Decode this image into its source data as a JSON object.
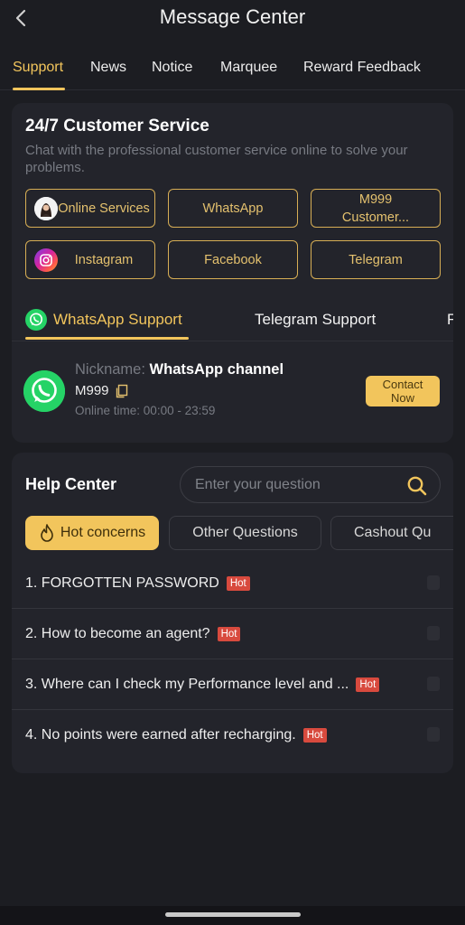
{
  "header": {
    "title": "Message Center"
  },
  "tabs": [
    {
      "label": "Support",
      "active": true
    },
    {
      "label": "News",
      "active": false
    },
    {
      "label": "Notice",
      "active": false
    },
    {
      "label": "Marquee",
      "active": false
    },
    {
      "label": "Reward Feedback",
      "active": false
    }
  ],
  "customer_service": {
    "title": "24/7 Customer Service",
    "subtitle": "Chat with the professional customer service online to solve your problems.",
    "buttons": [
      {
        "label": "Online Services",
        "icon": "agent-avatar-icon"
      },
      {
        "label": "WhatsApp",
        "icon": ""
      },
      {
        "label": "M999 Customer...",
        "icon": ""
      },
      {
        "label": "Instagram",
        "icon": "instagram-icon"
      },
      {
        "label": "Facebook",
        "icon": ""
      },
      {
        "label": "Telegram",
        "icon": ""
      }
    ],
    "support_tabs": [
      {
        "label": "WhatsApp Support",
        "active": true
      },
      {
        "label": "Telegram Support",
        "active": false
      },
      {
        "label": "F",
        "active": false
      }
    ],
    "channel": {
      "nickname_label": "Nickname:",
      "nickname": "WhatsApp channel",
      "account": "M999",
      "online_label": "Online time:",
      "online_time": "00:00 - 23:59",
      "contact_label": "Contact Now"
    }
  },
  "help_center": {
    "title": "Help Center",
    "search_placeholder": "Enter your question",
    "categories": [
      {
        "label": "Hot concerns",
        "active": true
      },
      {
        "label": "Other Questions",
        "active": false
      },
      {
        "label": "Cashout Qu",
        "active": false
      }
    ],
    "hot_badge": "Hot",
    "questions": [
      "1. FORGOTTEN PASSWORD",
      "2. How to become an agent?",
      "3. Where can I check my Performance level and ...",
      "4. No points were earned after recharging."
    ]
  },
  "colors": {
    "background": "#1c1d22",
    "card": "#23242b",
    "accent": "#f2c55c",
    "hot": "#d84a3e",
    "whatsapp": "#25d366"
  }
}
